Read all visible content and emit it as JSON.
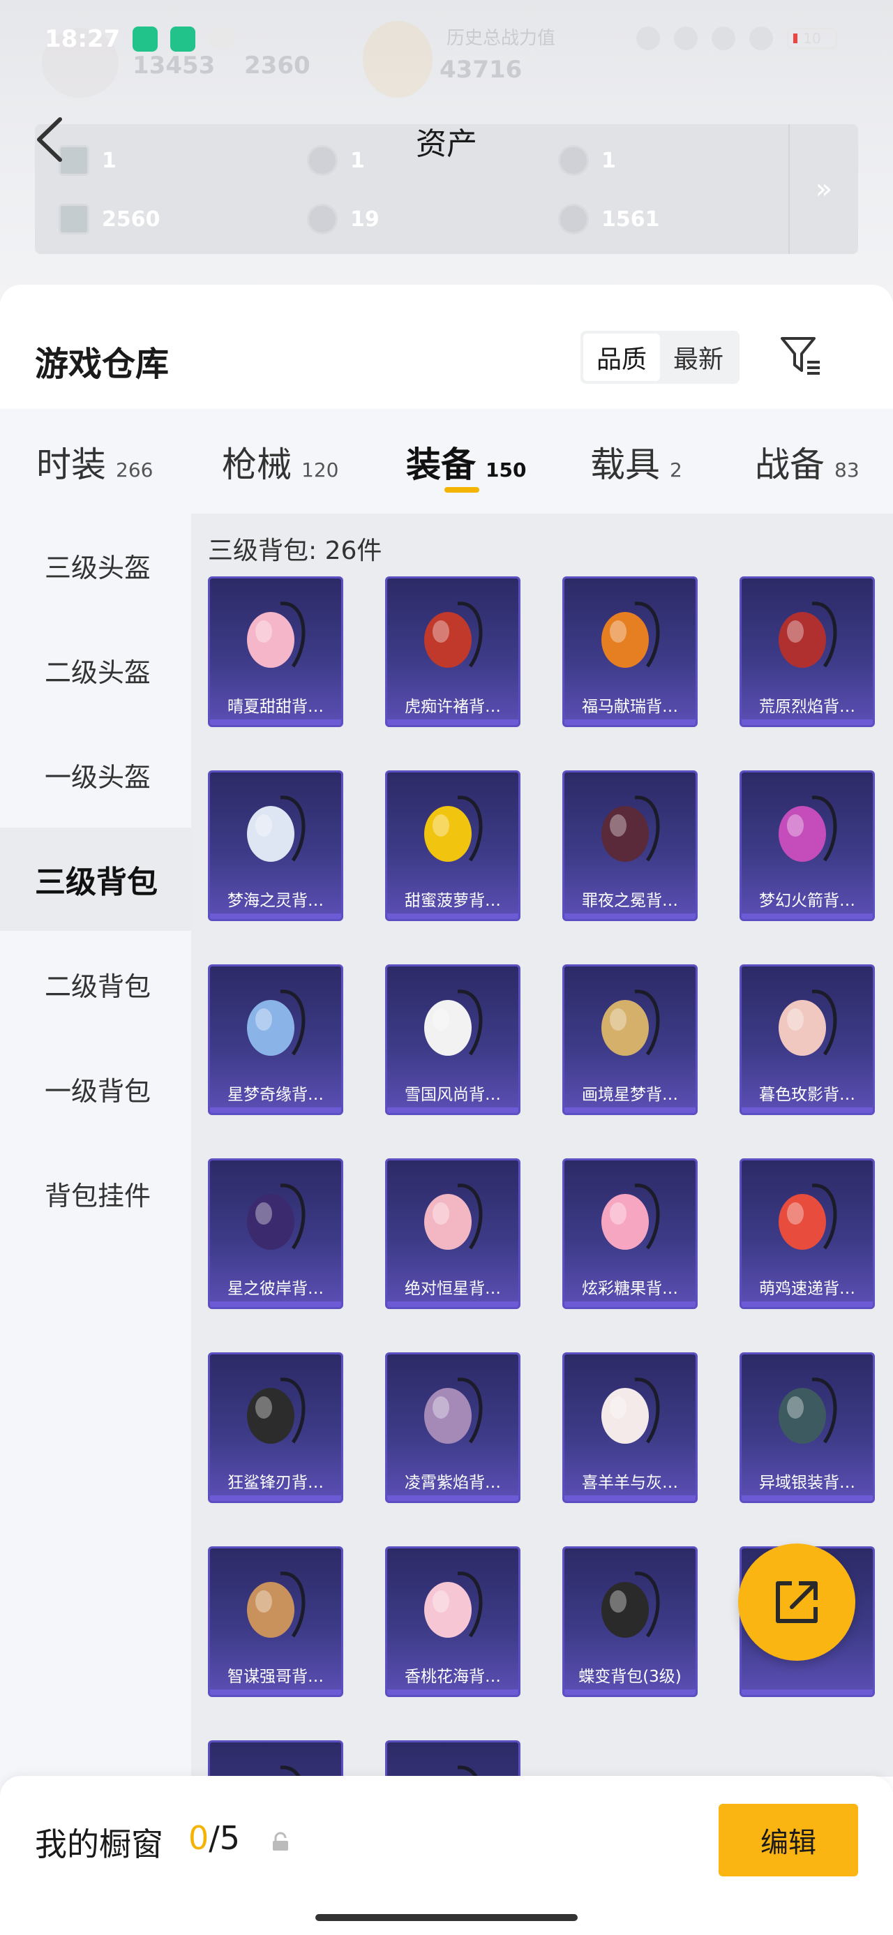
{
  "status_bar": {
    "time": "18:27",
    "battery": "10"
  },
  "background_stats": {
    "value_a": "13453",
    "value_b": "2360",
    "label_history": "历史总战力值",
    "value_c": "43716"
  },
  "header": {
    "title": "资产"
  },
  "assets": [
    {
      "icon": "card-icon",
      "value": "1"
    },
    {
      "icon": "coin-silver-icon",
      "value": "1"
    },
    {
      "icon": "coin-gold-icon",
      "value": "1"
    },
    {
      "icon": "voucher-icon",
      "value": "2560"
    },
    {
      "icon": "coin-grey-icon",
      "value": "19"
    },
    {
      "icon": "coin-bronze-icon",
      "value": "1561"
    }
  ],
  "warehouse": {
    "title": "游戏仓库",
    "sort_options": [
      "品质",
      "最新"
    ],
    "active_sort": "品质"
  },
  "tabs": [
    {
      "label": "时装",
      "count": "266"
    },
    {
      "label": "枪械",
      "count": "120"
    },
    {
      "label": "装备",
      "count": "150",
      "active": true
    },
    {
      "label": "载具",
      "count": "2"
    },
    {
      "label": "战备",
      "count": "83"
    }
  ],
  "sidebar": {
    "items": [
      {
        "label": "三级头盔"
      },
      {
        "label": "二级头盔"
      },
      {
        "label": "一级头盔"
      },
      {
        "label": "三级背包",
        "active": true
      },
      {
        "label": "二级背包"
      },
      {
        "label": "一级背包"
      },
      {
        "label": "背包挂件"
      }
    ]
  },
  "section": {
    "count_label": "三级背包: 26件"
  },
  "items": [
    {
      "name": "晴夏甜甜背…",
      "color": "#f4b6c8"
    },
    {
      "name": "虎痴许褚背…",
      "color": "#c0392b"
    },
    {
      "name": "福马献瑞背…",
      "color": "#e67e22"
    },
    {
      "name": "荒原烈焰背…",
      "color": "#b03030"
    },
    {
      "name": "梦海之灵背…",
      "color": "#dfe6f3"
    },
    {
      "name": "甜蜜菠萝背…",
      "color": "#f1c40f"
    },
    {
      "name": "罪夜之冕背…",
      "color": "#5a2a3a"
    },
    {
      "name": "梦幻火箭背…",
      "color": "#c44dbb"
    },
    {
      "name": "星梦奇缘背…",
      "color": "#8ab4e8"
    },
    {
      "name": "雪国风尚背…",
      "color": "#f2f2f2"
    },
    {
      "name": "画境星梦背…",
      "color": "#d4b06a"
    },
    {
      "name": "暮色玫影背…",
      "color": "#f0c8c0"
    },
    {
      "name": "星之彼岸背…",
      "color": "#3b2a6e"
    },
    {
      "name": "绝对恒星背…",
      "color": "#f3b7c4"
    },
    {
      "name": "炫彩糖果背…",
      "color": "#f7a6c2"
    },
    {
      "name": "萌鸡速递背…",
      "color": "#e74c3c"
    },
    {
      "name": "狂鲨锋刃背…",
      "color": "#2c2c2c"
    },
    {
      "name": "凌霄紫焰背…",
      "color": "#a58ab8"
    },
    {
      "name": "喜羊羊与灰…",
      "color": "#f5eaea"
    },
    {
      "name": "异域银装背…",
      "color": "#3d5a60"
    },
    {
      "name": "智谋强哥背…",
      "color": "#c9925c"
    },
    {
      "name": "香桃花海背…",
      "color": "#f6c6d4"
    },
    {
      "name": "蝶变背包(3级)",
      "color": "#2a2a2a"
    },
    {
      "name": "",
      "color": "#6c7fb8"
    },
    {
      "name": "",
      "color": "#6fbf8a"
    },
    {
      "name": "",
      "color": "#9fd4b0"
    }
  ],
  "showcase": {
    "label": "我的橱窗",
    "used": "0",
    "separator": "/",
    "total": "5"
  },
  "edit_button": {
    "label": "编辑"
  },
  "colors": {
    "accent": "#fbb512",
    "card_bg": "#3d3b87",
    "card_border": "#5b4fc2"
  }
}
